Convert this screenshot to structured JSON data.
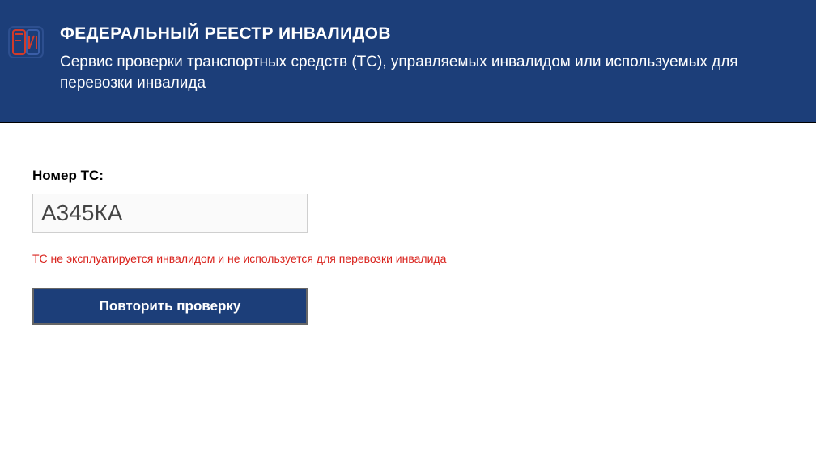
{
  "header": {
    "title": "ФЕДЕРАЛЬНЫЙ РЕЕСТР ИНВАЛИДОВ",
    "subtitle": "Сервис проверки транспортных средств (ТС), управляемых инвалидом или используемых для перевозки инвалида",
    "logo_colors": {
      "outer": "#1c3e79",
      "f_stroke": "#d13b2a",
      "r_stroke": "#3b5ea8",
      "i_stroke": "#d13b2a"
    }
  },
  "form": {
    "label": "Номер ТС:",
    "value": "А345КА",
    "error": "ТС не эксплуатируется инвалидом и не используется для перевозки инвалида",
    "button": "Повторить проверку"
  }
}
